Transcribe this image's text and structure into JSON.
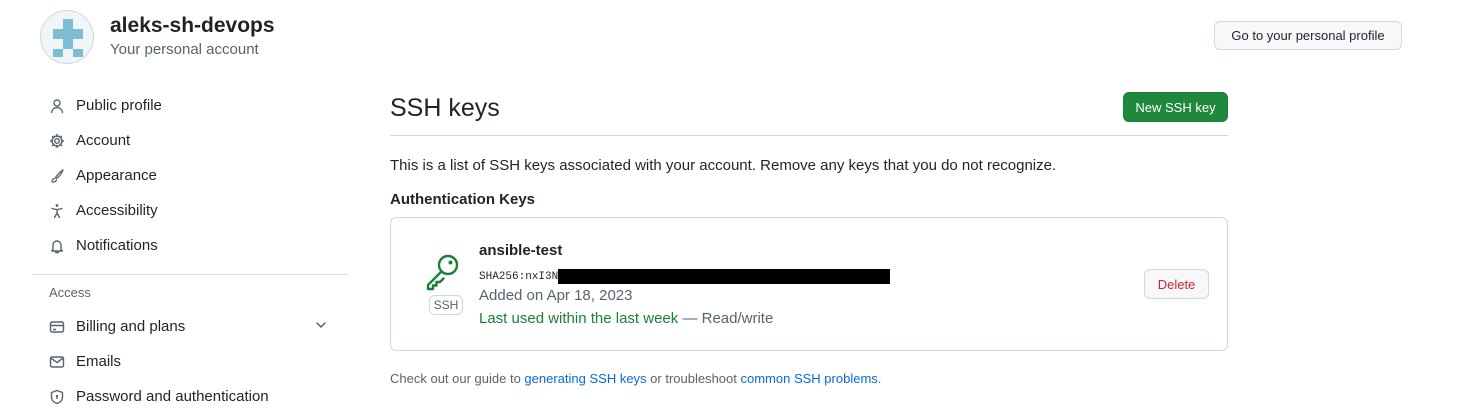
{
  "account": {
    "name": "aleks-sh-devops",
    "subtitle": "Your personal account",
    "profile_button": "Go to your personal profile"
  },
  "sidebar": {
    "items": [
      {
        "label": "Public profile",
        "icon": "person-icon"
      },
      {
        "label": "Account",
        "icon": "gear-icon"
      },
      {
        "label": "Appearance",
        "icon": "paintbrush-icon"
      },
      {
        "label": "Accessibility",
        "icon": "accessibility-icon"
      },
      {
        "label": "Notifications",
        "icon": "bell-icon"
      }
    ],
    "section_label": "Access",
    "access_items": [
      {
        "label": "Billing and plans",
        "icon": "credit-card-icon"
      },
      {
        "label": "Emails",
        "icon": "mail-icon"
      },
      {
        "label": "Password and authentication",
        "icon": "shield-lock-icon"
      }
    ]
  },
  "main": {
    "title": "SSH keys",
    "new_key_button": "New SSH key",
    "intro": "This is a list of SSH keys associated with your account. Remove any keys that you do not recognize.",
    "auth_keys_title": "Authentication Keys",
    "key": {
      "name": "ansible-test",
      "fingerprint_prefix": "SHA256:nxI3N",
      "type_label": "SSH",
      "added": "Added on Apr 18, 2023",
      "last_used": "Last used within the last week",
      "access": " — Read/write",
      "delete_button": "Delete"
    },
    "footer": {
      "text1": "Check out our guide to ",
      "link1": "generating SSH keys",
      "text2": " or troubleshoot ",
      "link2": "common SSH problems",
      "text3": "."
    }
  },
  "colors": {
    "primary_button": "#1f883d",
    "link": "#0969da",
    "success": "#1a7f37",
    "danger": "#d1242f"
  }
}
